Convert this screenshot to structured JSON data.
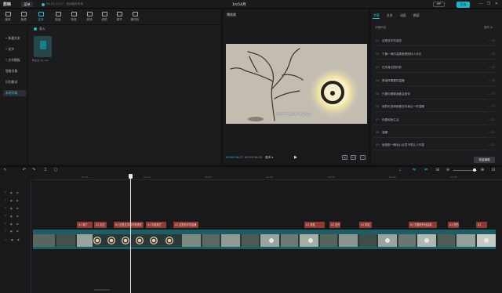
{
  "titlebar": {
    "app_name": "剪映",
    "menu_label": "菜单",
    "autosave": "06-23 21:27 · 自动保存本地",
    "project_title": "1m54月",
    "vip_label": "VIP",
    "export_label": "导出",
    "window_controls": [
      "—",
      "❐",
      "✕"
    ]
  },
  "tool_tabs": [
    {
      "label": "媒体",
      "icon": "media-icon"
    },
    {
      "label": "音频",
      "icon": "audio-icon"
    },
    {
      "label": "文本",
      "icon": "text-icon",
      "active": true
    },
    {
      "label": "贴纸",
      "icon": "sticker-icon"
    },
    {
      "label": "特效",
      "icon": "effects-icon"
    },
    {
      "label": "转场",
      "icon": "transition-icon"
    },
    {
      "label": "滤镜",
      "icon": "filter-icon"
    },
    {
      "label": "调节",
      "icon": "adjust-icon"
    },
    {
      "label": "素材包",
      "icon": "pack-icon"
    }
  ],
  "side_nav": [
    {
      "label": "• 新建文本"
    },
    {
      "label": "• 花字"
    },
    {
      "label": "• 文字模板"
    },
    {
      "label": "智能字幕"
    },
    {
      "label": "识别歌词"
    },
    {
      "label": "本地字幕",
      "active": true
    }
  ],
  "media": {
    "import_label": "导入",
    "thumb_caption": "新生主 (3)_ceo"
  },
  "player": {
    "title": "播放器",
    "subtitle_overlay": "这些文字将不断重复循环",
    "time_current": "00:00:16:27",
    "time_total": "00:23:30:00",
    "quality_label": "原声 ▾",
    "play_icon": "▶",
    "buttons": [
      "⊞",
      "1:1",
      "⛶"
    ]
  },
  "right_panel": {
    "tabs": [
      "字幕",
      "文本",
      "动画",
      "朗读"
    ],
    "list_header_left": "字幕内容",
    "list_header_right": "操作 ⊕",
    "rows": [
      {
        "num": "01",
        "text": "这是双手的温热"
      },
      {
        "num": "02",
        "text": "千篇一律的温柔都是陪伴人评论"
      },
      {
        "num": "03",
        "text": "在你身边陪伴你"
      },
      {
        "num": "04",
        "text": "是谁所需要的温暖"
      },
      {
        "num": "05",
        "text": "只要你需要我都会陪伴"
      },
      {
        "num": "06",
        "text": "就算天涯海角都在你身边一样温暖"
      },
      {
        "num": "07",
        "text": "你要和我生活"
      },
      {
        "num": "08",
        "text": "温暖"
      },
      {
        "num": "09",
        "text": "就是那一瞬全心全意不想让人失望"
      }
    ],
    "row_ops": "⌯  ⌫",
    "batch_label": "批量编辑"
  },
  "timeline": {
    "ruler": [
      "00:15",
      "00:20",
      "00:25",
      "00:30",
      "00:35",
      "00:40",
      "00:45",
      "00:50"
    ],
    "track_controls": [
      "T ● ◉",
      "T ● ◉",
      "T ● ◉",
      "T ● ◉",
      "T ● ◉",
      "T ● ◉"
    ],
    "main_track": "▭ ● ◉",
    "subtitle_clips": [
      "A1 嗨了",
      "A1 高光",
      "A1 这是文字将不断重复",
      "A1 你看着它",
      "A1 这是双手的温暖",
      "A1 搞笑",
      "A1 还行",
      "A1 搞定",
      "A1 只要好好地活着",
      "A1 好的",
      "A1"
    ]
  }
}
